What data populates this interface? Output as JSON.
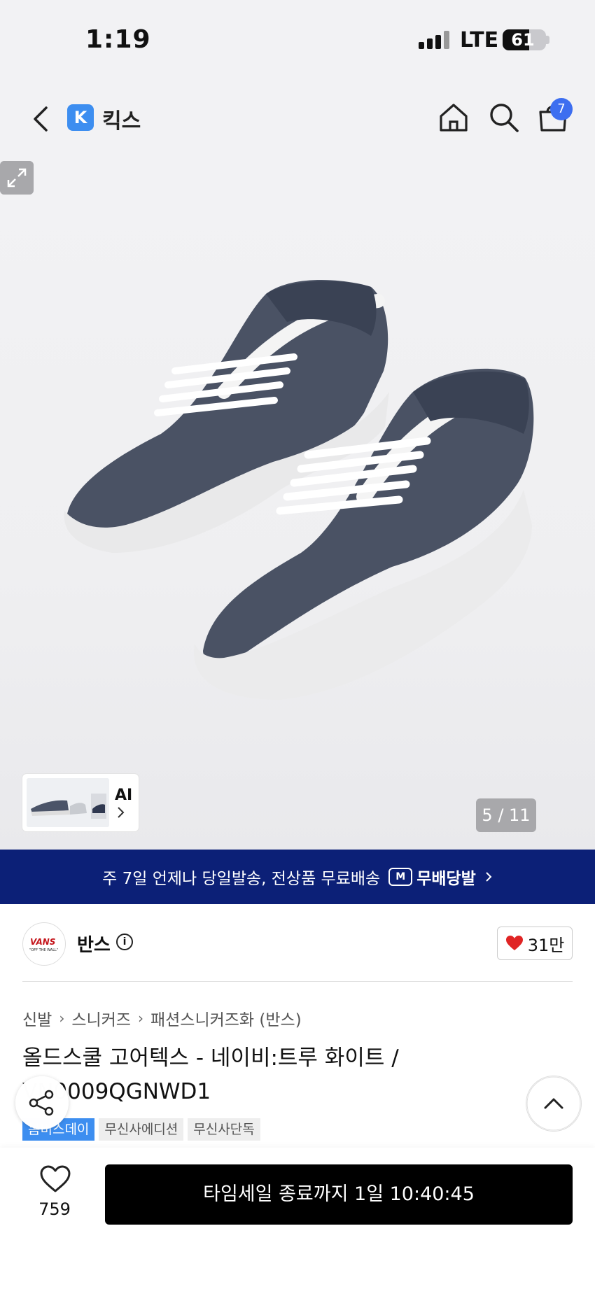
{
  "status": {
    "time": "1:19",
    "network": "LTE",
    "battery": "61",
    "battery_level": 0.61
  },
  "nav": {
    "store_logo_letter": "K",
    "store_name": "킥스",
    "cart_count": "7",
    "icons": [
      "back-icon",
      "home-icon",
      "search-icon",
      "cart-icon"
    ]
  },
  "gallery": {
    "thumbnail_label": "AI",
    "counter": "5 / 11",
    "icons": [
      "chevron-right-icon",
      "expand-icon"
    ]
  },
  "banner": {
    "text": "주 7일 언제나 당일발송, 전상품 무료배송",
    "badge_icon_text": "M",
    "badge_label": "무배당발"
  },
  "brand": {
    "logo_text": "VANS",
    "logo_sub": "\"OFF THE WALL\"",
    "name": "반스",
    "likes": "31만",
    "accent": "#e02424"
  },
  "breadcrumb": [
    "신발",
    "스니커즈",
    "패션스니커즈화 (반스)"
  ],
  "product": {
    "title": "올드스쿨 고어텍스 - 네이비:트루 화이트 / VN0009QGNWD1",
    "tags": [
      {
        "label": "봄비스데이",
        "style": "blue"
      },
      {
        "label": "무신사에디션",
        "style": "gray"
      },
      {
        "label": "무신사단독",
        "style": "gray"
      }
    ]
  },
  "bottom": {
    "like_count": "759",
    "cta_label": "타임세일 종료까지 1일 10:40:45"
  },
  "colors": {
    "banner_bg": "#0c2077",
    "tag_blue": "#3d8ef0",
    "badge": "#3d6ef0",
    "cta_bg": "#000000"
  }
}
